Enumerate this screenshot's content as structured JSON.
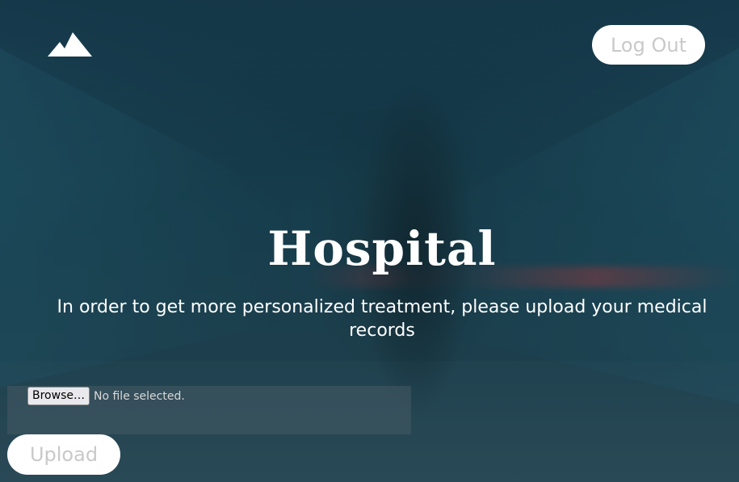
{
  "header": {
    "logo_icon": "mountain-icon",
    "logout_label": "Log Out"
  },
  "main": {
    "title": "Hospital",
    "subtitle": "In order to get more personalized treatment, please upload your medical records"
  },
  "upload_form": {
    "browse_label": "Browse…",
    "file_status": "No file selected.",
    "upload_label": "Upload"
  },
  "colors": {
    "button_bg": "#ffffff",
    "button_text": "#c9c9c9",
    "title_text": "#ffffff",
    "overlay": "#0f2c3a"
  }
}
